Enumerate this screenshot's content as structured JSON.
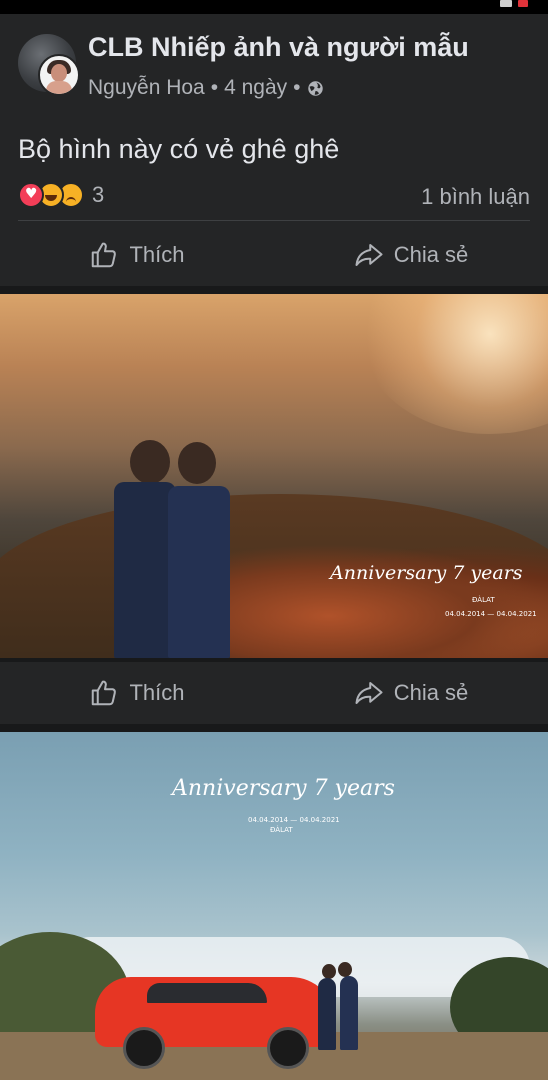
{
  "post": {
    "group_name": "CLB Nhiếp ảnh và người mẫu",
    "author": "Nguyễn Hoa",
    "separator": "•",
    "time": "4 ngày",
    "privacy_icon": "globe-icon",
    "text": "Bộ hình này có vẻ ghê ghê",
    "reactions": [
      "love-reaction-icon",
      "haha-reaction-icon",
      "sad-reaction-icon"
    ],
    "reaction_count": "3",
    "comments": "1 bình luận"
  },
  "actions": {
    "like_label": "Thích",
    "share_label": "Chia sẻ"
  },
  "photos": [
    {
      "watermark_title": "Anniversary 7 years",
      "watermark_place": "ĐÀLAT",
      "watermark_dates": "04.04.2014 — 04.04.2021"
    },
    {
      "watermark_title": "Anniversary 7 years",
      "watermark_place": "ĐÀLAT",
      "watermark_dates": "04.04.2014 — 04.04.2021"
    }
  ],
  "colors": {
    "background": "#18191a",
    "card": "#242526",
    "primary_text": "#e4e6eb",
    "secondary_text": "#b0b3b8",
    "love": "#f33e58",
    "haha": "#f7b125"
  }
}
